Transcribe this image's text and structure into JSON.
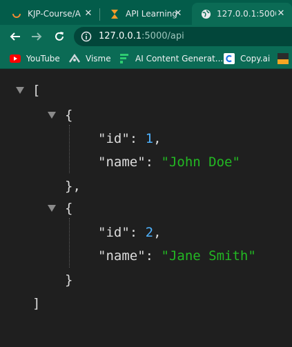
{
  "tabs": [
    {
      "title": "KJP-Course/A",
      "icon": "loading-spinner-icon",
      "close": "✕"
    },
    {
      "title": "API Learning",
      "icon": "hourglass-icon",
      "close": "✕"
    },
    {
      "title": "127.0.0.1:5000",
      "icon": "globe-icon",
      "close": "✕",
      "active": true
    }
  ],
  "toolbar": {
    "url_host": "127.0.0.1",
    "url_rest": ":5000/api"
  },
  "bookmarks": [
    {
      "label": "YouTube",
      "icon": "youtube-icon"
    },
    {
      "label": "Visme",
      "icon": "visme-icon"
    },
    {
      "label": "AI Content Generat...",
      "icon": "ai-content-icon"
    },
    {
      "label": "Copy.ai",
      "icon": "copyai-icon"
    }
  ],
  "json": {
    "open_array": "[",
    "close_array": "]",
    "objects": [
      {
        "open": "{",
        "close": "},",
        "id_key": "\"id\"",
        "id_value": "1",
        "name_key": "\"name\"",
        "name_value": "\"John Doe\""
      },
      {
        "open": "{",
        "close": "}",
        "id_key": "\"id\"",
        "id_value": "2",
        "name_key": "\"name\"",
        "name_value": "\"Jane Smith\""
      }
    ],
    "colon": ": ",
    "comma": ","
  },
  "colors": {
    "frame": "#0b6b55",
    "tabstrip": "#035c4a",
    "viewer_bg": "#1f1f1f",
    "number": "#4fb3ff",
    "string": "#23b823"
  }
}
